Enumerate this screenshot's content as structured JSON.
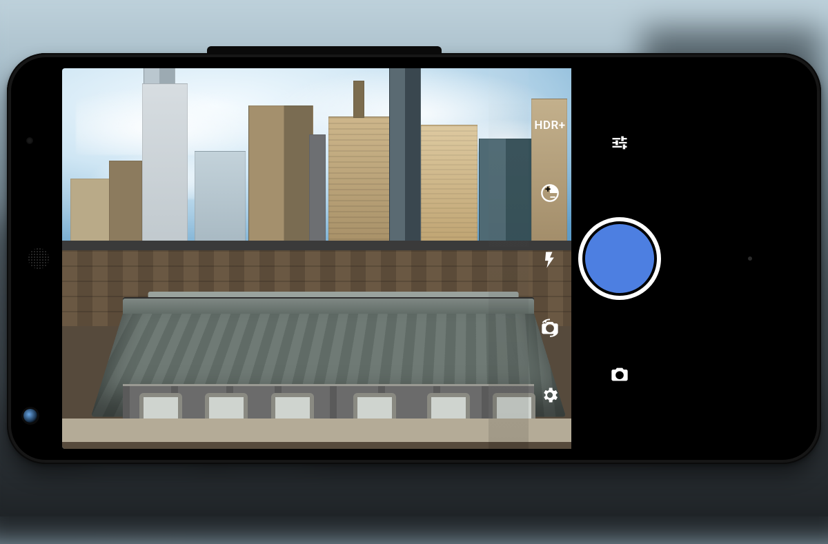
{
  "hdr_label": "HDR+",
  "colors": {
    "shutter": "#4d7fe1"
  },
  "icons": {
    "exposure": "exposure-toggle-icon",
    "flash": "flash-icon",
    "switch_camera": "switch-camera-icon",
    "settings": "settings-gear-icon",
    "tune": "tune-sliders-icon",
    "mode": "camera-mode-icon"
  }
}
